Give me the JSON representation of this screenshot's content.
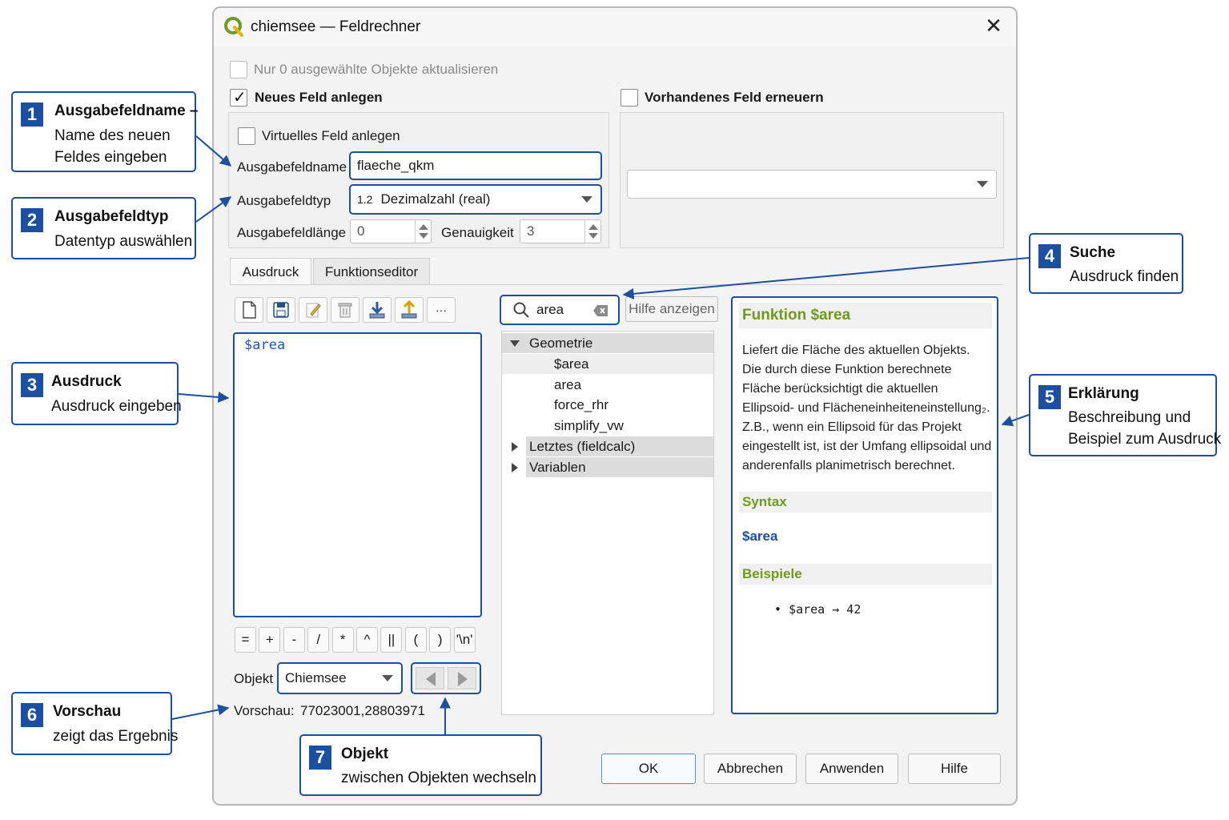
{
  "window": {
    "title": "chiemsee — Feldrechner",
    "close_label": "✕"
  },
  "options": {
    "only_selected": "Nur 0 ausgewählte Objekte aktualisieren",
    "new_field": "Neues Feld anlegen",
    "update_existing": "Vorhandenes Feld erneuern",
    "virtual_field": "Virtuelles Feld anlegen"
  },
  "form": {
    "output_name_label": "Ausgabefeldname",
    "output_name_value": "flaeche_qkm",
    "output_type_label": "Ausgabefeldtyp",
    "output_type_icon": "1.2",
    "output_type_value": "Dezimalzahl (real)",
    "output_length_label": "Ausgabefeldlänge",
    "output_length_value": "0",
    "precision_label": "Genauigkeit",
    "precision_value": "3"
  },
  "tabs": [
    {
      "label": "Ausdruck"
    },
    {
      "label": "Funktionseditor"
    }
  ],
  "toolbar": {
    "more_label": "···"
  },
  "expression": {
    "text": "$area"
  },
  "operators": [
    "=",
    "+",
    "-",
    "/",
    "*",
    "^",
    "||",
    "(",
    ")",
    "'\\n'"
  ],
  "object": {
    "label": "Objekt",
    "value": "Chiemsee"
  },
  "preview": {
    "label": "Vorschau:",
    "value": "77023001,28803971"
  },
  "search": {
    "value": "area",
    "help_button": "Hilfe anzeigen"
  },
  "tree": {
    "groups": [
      {
        "label": "Geometrie",
        "expanded": true,
        "items": [
          "$area",
          "area",
          "force_rhr",
          "simplify_vw"
        ]
      },
      {
        "label": "Letztes (fieldcalc)",
        "expanded": false,
        "items": []
      },
      {
        "label": "Variablen",
        "expanded": false,
        "items": []
      }
    ]
  },
  "help": {
    "title": "Funktion $area",
    "description": "Liefert die Fläche des aktuellen Objekts. Die durch diese Funktion berechnete Fläche berücksichtigt die aktuellen Ellipsoid- und Flächeneinheiteneinstellung₂. Z.B., wenn ein Ellipsoid für das Projekt eingestellt ist, ist der Umfang ellipsoidal und anderenfalls planimetrisch berechnet.",
    "syntax_heading": "Syntax",
    "syntax": "$area",
    "examples_heading": "Beispiele",
    "example": "$area → 42"
  },
  "buttons": {
    "ok": "OK",
    "cancel": "Abbrechen",
    "apply": "Anwenden",
    "help": "Hilfe"
  },
  "callouts": [
    {
      "num": "1",
      "title": "Ausgabefeldname –",
      "desc": [
        "Name des neuen",
        "Feldes eingeben"
      ]
    },
    {
      "num": "2",
      "title": "Ausgabefeldtyp",
      "desc": [
        "Datentyp auswählen"
      ]
    },
    {
      "num": "3",
      "title": "Ausdruck",
      "desc": [
        "Ausdruck eingeben"
      ]
    },
    {
      "num": "4",
      "title": "Suche",
      "desc": [
        "Ausdruck finden"
      ]
    },
    {
      "num": "5",
      "title": "Erklärung",
      "desc": [
        "Beschreibung und",
        "Beispiel zum Ausdruck"
      ]
    },
    {
      "num": "6",
      "title": "Vorschau",
      "desc": [
        "zeigt das Ergebnis"
      ]
    },
    {
      "num": "7",
      "title": "Objekt",
      "desc": [
        "zwischen Objekten wechseln"
      ]
    }
  ],
  "colors": {
    "accent": "#1b4fa0",
    "help_heading": "#6e9a1e",
    "code": "#2156b0"
  }
}
